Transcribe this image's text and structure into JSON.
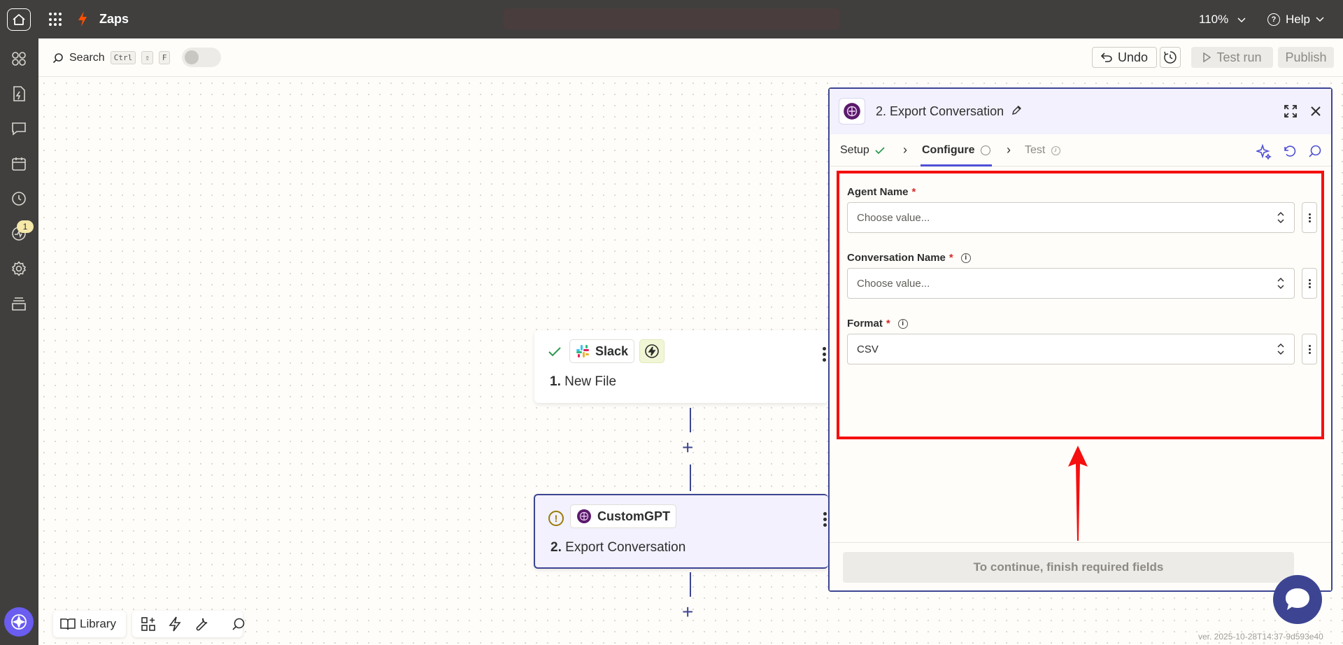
{
  "topbar": {
    "title": "Zaps",
    "zoom": "110%",
    "help": "Help"
  },
  "rail": {
    "badge_count": "1"
  },
  "toolbar": {
    "search_label": "Search",
    "kbd_ctrl": "Ctrl",
    "kbd_shift": "⇧",
    "kbd_f": "F",
    "undo_label": "Undo",
    "test_run_label": "Test run",
    "publish_label": "Publish"
  },
  "steps": [
    {
      "app": "Slack",
      "number": "1.",
      "title": "New File"
    },
    {
      "app": "CustomGPT",
      "number": "2.",
      "title": "Export Conversation"
    }
  ],
  "bottom_tools": {
    "library_label": "Library"
  },
  "panel": {
    "title": "2. Export Conversation",
    "tabs": [
      {
        "label": "Setup",
        "status": "done"
      },
      {
        "label": "Configure",
        "status": "active"
      },
      {
        "label": "Test",
        "status": "pending"
      }
    ],
    "fields": [
      {
        "label": "Agent Name",
        "required": "*",
        "value": "Choose value..."
      },
      {
        "label": "Conversation Name",
        "required": "*",
        "value": "Choose value..."
      },
      {
        "label": "Format",
        "required": "*",
        "value": "CSV"
      }
    ],
    "continue_label": "To continue, finish required fields"
  },
  "version": "ver. 2025-10-28T14:37-9d593e40",
  "colors": {
    "topbar_bg": "#403f3e",
    "accent": "#3d4592",
    "zap_orange": "#ff4f00",
    "highlight_red": "#f50f0f"
  }
}
